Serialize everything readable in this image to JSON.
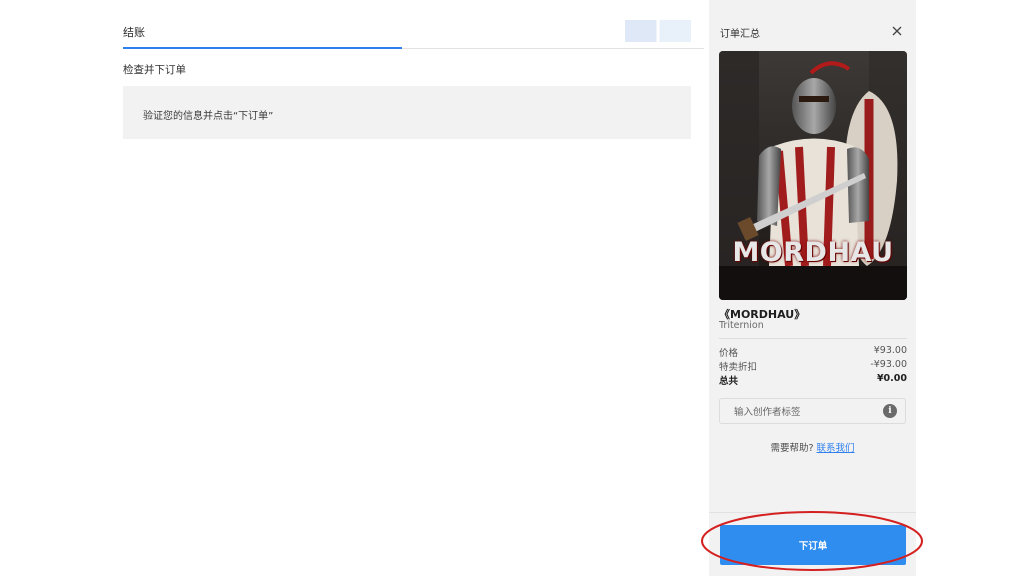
{
  "checkout": {
    "tab_label": "结账",
    "section_title": "检查并下订单",
    "notice_text": "验证您的信息并点击“下订单”"
  },
  "summary": {
    "title": "订单汇总",
    "close_icon": "close-icon",
    "cover_title": "MORDHAU",
    "game_name": "《MORDHAU》",
    "publisher": "Triternion",
    "price_label": "价格",
    "price_value": "¥93.00",
    "discount_label": "特卖折扣",
    "discount_value": "-¥93.00",
    "total_label": "总共",
    "total_value": "¥0.00",
    "creator_placeholder": "输入创作者标签",
    "info_icon": "info-icon",
    "help_text": "需要帮助?",
    "help_link": "联系我们",
    "place_order_label": "下订单"
  },
  "colors": {
    "accent": "#2f80ed",
    "button": "#2f8df0",
    "highlight": "#d42020"
  }
}
